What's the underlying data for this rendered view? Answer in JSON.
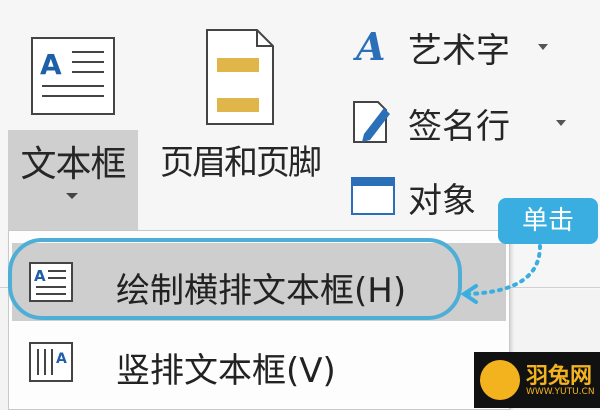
{
  "ribbon": {
    "text_box": {
      "label": "文本框",
      "icon": "text-box-icon"
    },
    "header_footer": {
      "label": "页眉和页脚",
      "icon": "header-footer-icon"
    },
    "word_art": {
      "label": "艺术字",
      "icon": "word-art-icon"
    },
    "signature_line": {
      "label": "签名行",
      "icon": "signature-line-icon"
    },
    "object": {
      "label": "对象",
      "icon": "object-icon"
    }
  },
  "dropdown": {
    "items": [
      {
        "label": "绘制横排文本框(H)",
        "icon": "horizontal-text-box-icon",
        "highlighted": true
      },
      {
        "label": "竖排文本框(V)",
        "icon": "vertical-text-box-icon",
        "highlighted": false
      }
    ]
  },
  "annotation": {
    "callout": "单击",
    "color": "#3aaee0"
  },
  "watermark": {
    "brand": "羽兔网",
    "url": "WWW.YUTU.CN",
    "color": "#f2b31f"
  }
}
